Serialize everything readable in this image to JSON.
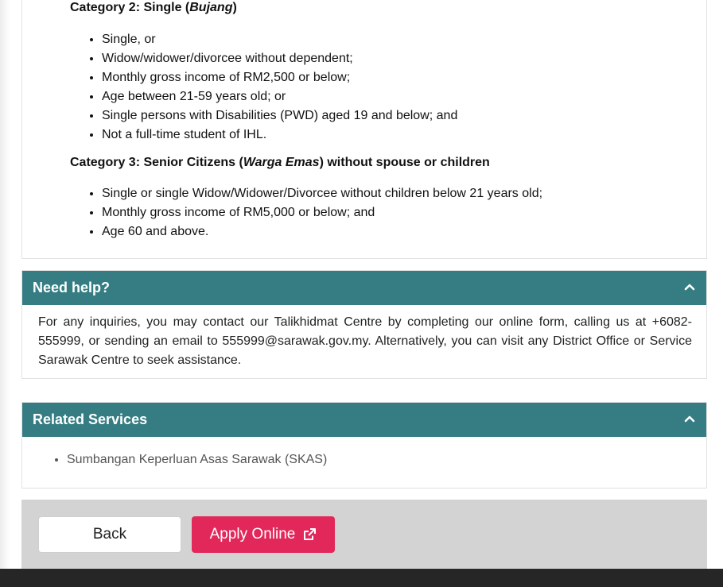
{
  "eligibility": {
    "category2": {
      "prefix": "Category 2: Single (",
      "italic": "Bujang",
      "suffix": ")",
      "items": [
        "Single, or",
        "Widow/widower/divorcee without dependent;",
        "Monthly gross income of RM2,500 or below;",
        "Age between 21-59 years old; or",
        "Single persons with Disabilities (PWD) aged 19 and below; and",
        "Not a full-time student of IHL."
      ]
    },
    "category3": {
      "prefix": "Category 3: Senior Citizens (",
      "italic": "Warga Emas",
      "suffix": ") without spouse or children",
      "items": [
        "Single or single Widow/Widower/Divorcee without children below 21 years old;",
        "Monthly gross income of RM5,000 or below; and",
        "Age 60 and above."
      ]
    }
  },
  "help": {
    "title": "Need help?",
    "text": "For any inquiries, you may contact our Talikhidmat Centre by completing our online form, calling us at +6082-555999, or sending an email to 555999@sarawak.gov.my. Alternatively, you can visit any District Office or Service Sarawak Centre to seek assistance."
  },
  "related": {
    "title": "Related Services",
    "items": [
      "Sumbangan Keperluan Asas Sarawak (SKAS)"
    ]
  },
  "actions": {
    "back_label": "Back",
    "apply_label": "Apply Online"
  },
  "icons": {
    "collapse": "chevron-up-icon",
    "external": "external-link-icon"
  },
  "colors": {
    "panel_header": "#357d83",
    "apply_button": "#e2285a",
    "action_bar": "#d3d3d3",
    "footer": "#262626"
  }
}
